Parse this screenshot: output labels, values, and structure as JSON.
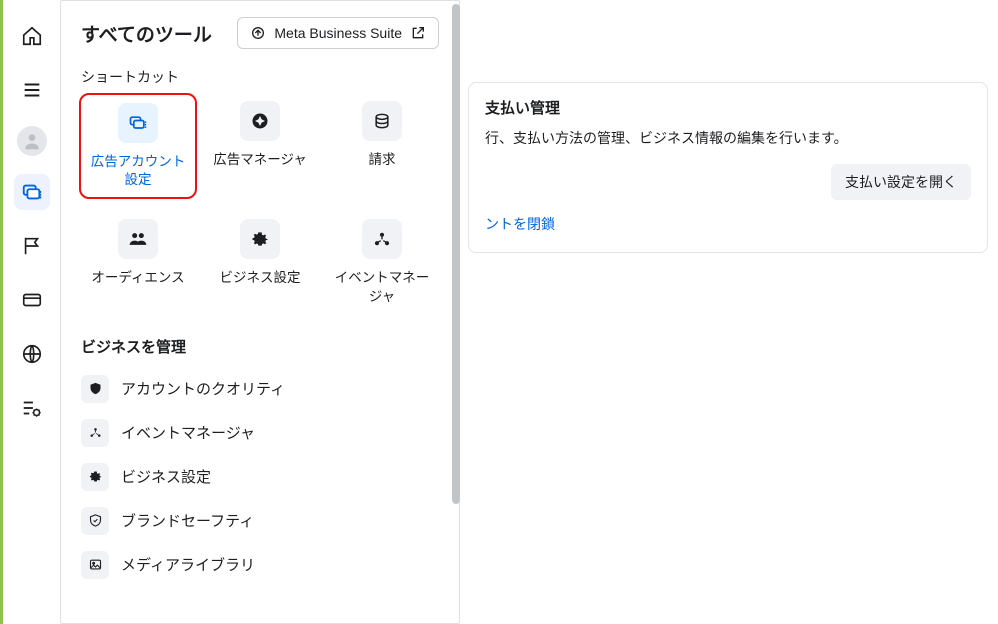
{
  "flyout": {
    "title": "すべてのツール",
    "mbs_button": "Meta Business Suite",
    "shortcuts_label": "ショートカット",
    "shortcuts": [
      {
        "label": "広告アカウント設定",
        "highlighted": true,
        "icon": "ad-settings"
      },
      {
        "label": "広告マネージャ",
        "icon": "compass"
      },
      {
        "label": "請求",
        "icon": "coins"
      },
      {
        "label": "オーディエンス",
        "icon": "audience"
      },
      {
        "label": "ビジネス設定",
        "icon": "gear"
      },
      {
        "label": "イベントマネージャ",
        "icon": "events"
      }
    ],
    "manage_heading": "ビジネスを管理",
    "manage_items": [
      {
        "label": "アカウントのクオリティ",
        "icon": "shield"
      },
      {
        "label": "イベントマネージャ",
        "icon": "events"
      },
      {
        "label": "ビジネス設定",
        "icon": "gear"
      },
      {
        "label": "ブランドセーフティ",
        "icon": "badge"
      },
      {
        "label": "メディアライブラリ",
        "icon": "media"
      }
    ]
  },
  "main": {
    "title": "支払い管理",
    "description": "行、支払い方法の管理、ビジネス情報の編集を行います。",
    "open_button": "支払い設定を開く",
    "link": "ントを閉鎖"
  }
}
